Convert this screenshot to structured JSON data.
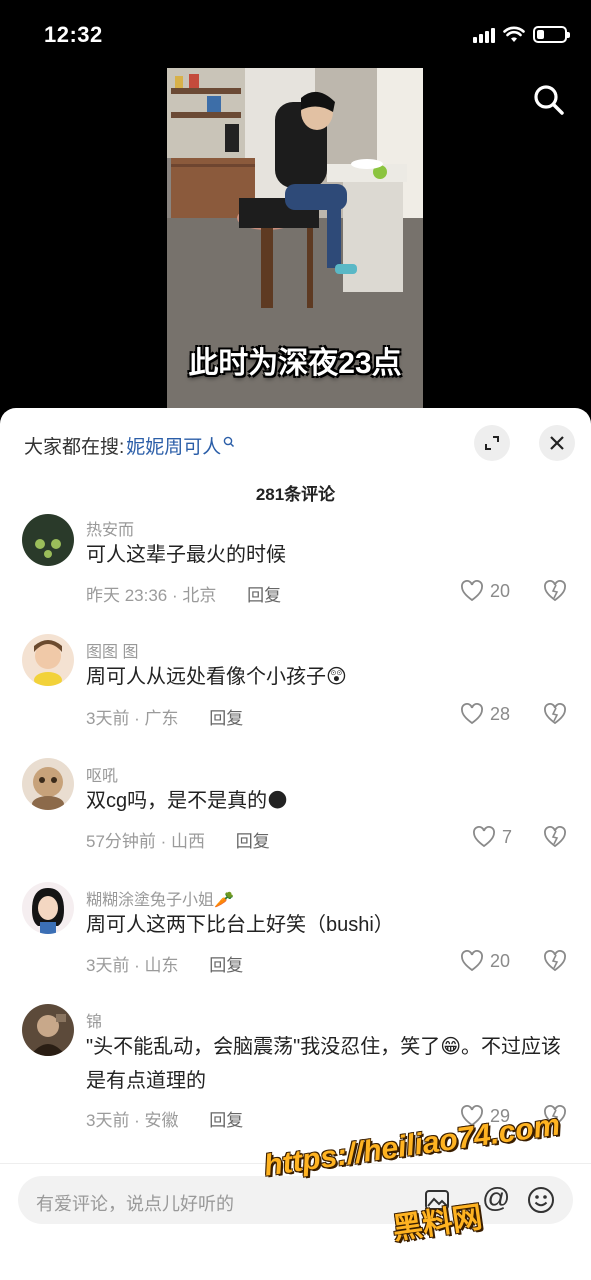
{
  "status_bar": {
    "time": "12:32",
    "battery_level": 0.25
  },
  "video": {
    "caption": "此时为深夜23点"
  },
  "comment_sheet": {
    "trend_prefix": "大家都在搜:",
    "trend_query": "妮妮周可人",
    "count_label": "281条评论"
  },
  "comments": [
    {
      "user": "热安而",
      "text": "可人这辈子最火的时候",
      "time_loc": "昨天 23:36 · 北京",
      "reply": "回复",
      "likes": "20"
    },
    {
      "user": "图图 图",
      "text": "周可人从远处看像个小孩子😲",
      "time_loc": "3天前 · 广东",
      "reply": "回复",
      "likes": "28"
    },
    {
      "user": "呕吼",
      "text": "双cg吗，是不是真的🌑",
      "time_loc": "57分钟前 · 山西",
      "reply": "回复",
      "likes": "7"
    },
    {
      "user": "糊糊涂塗兔子小姐🥕",
      "text": "周可人这两下比台上好笑（bushi）",
      "time_loc": "3天前 · 山东",
      "reply": "回复",
      "likes": "20"
    },
    {
      "user": "锦",
      "text": "\"头不能乱动，会脑震荡\"我没忍住，笑了😁。不过应该是有点道理的",
      "time_loc": "3天前 · 安徽",
      "reply": "回复",
      "likes": "29"
    }
  ],
  "input_bar": {
    "placeholder": "有爱评论，说点儿好听的"
  },
  "watermark": {
    "url": "https://heiliao74.com",
    "name": "黑料网"
  },
  "colors": {
    "accent_link": "#2b5ea8",
    "sheet_bg": "#ffffff",
    "watermark": "#ffb321"
  }
}
